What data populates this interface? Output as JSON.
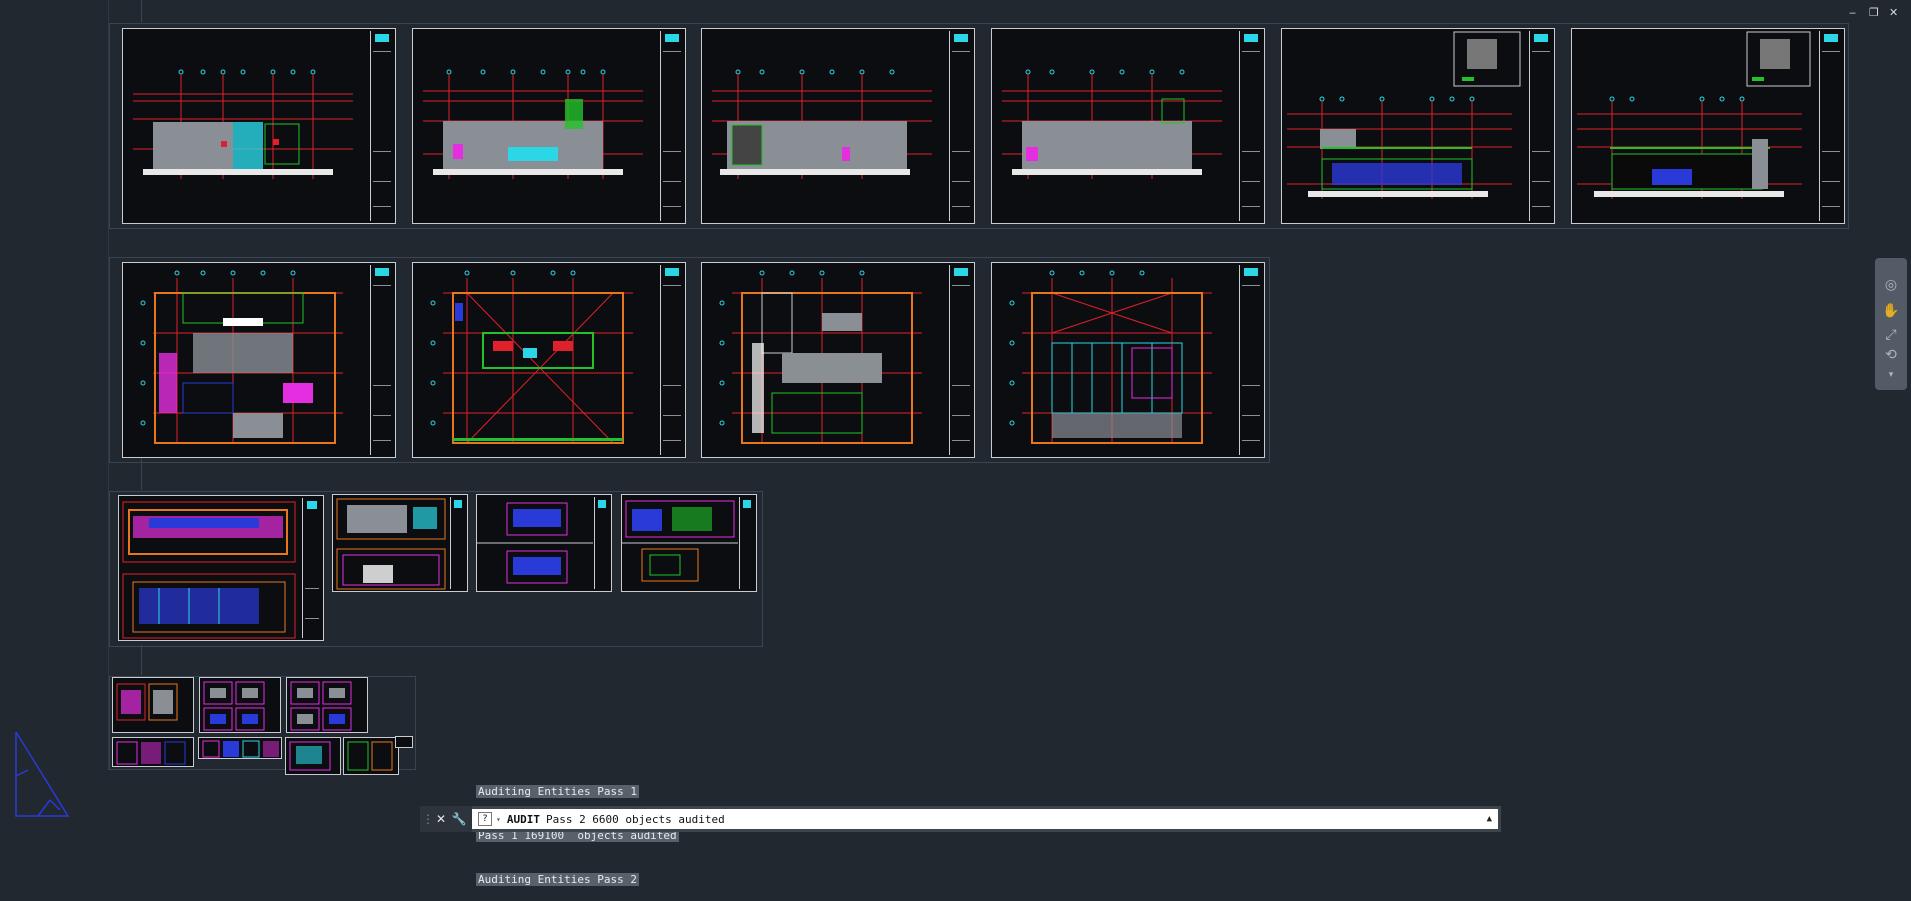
{
  "window_controls": {
    "minimize": "‒",
    "restore": "❐",
    "close": "✕"
  },
  "command_history": [
    "Auditing Entities Pass 1",
    "Pass 1 169100  objects audited",
    "Auditing Entities Pass 2"
  ],
  "command_line": {
    "command": "AUDIT",
    "text": "Pass 2 6600    objects audited",
    "close_icon": "close-icon",
    "settings_icon": "wrench-icon",
    "recent_icon": "command-recent-icon",
    "expand_icon": "chevron-up-icon"
  },
  "navigation_bar": {
    "items": [
      "steering-wheel-icon",
      "pan-icon",
      "zoom-icon",
      "orbit-icon",
      "showmotion-icon"
    ]
  },
  "colors": {
    "background": "#212830",
    "sheet_border": "#c8ccd2",
    "drawing_red": "#e0202a",
    "drawing_cyan": "#2bd6e6",
    "drawing_green": "#22c32a",
    "drawing_orange": "#e8761e",
    "drawing_magenta": "#e42ee0",
    "drawing_blue": "#2a3ad8"
  }
}
